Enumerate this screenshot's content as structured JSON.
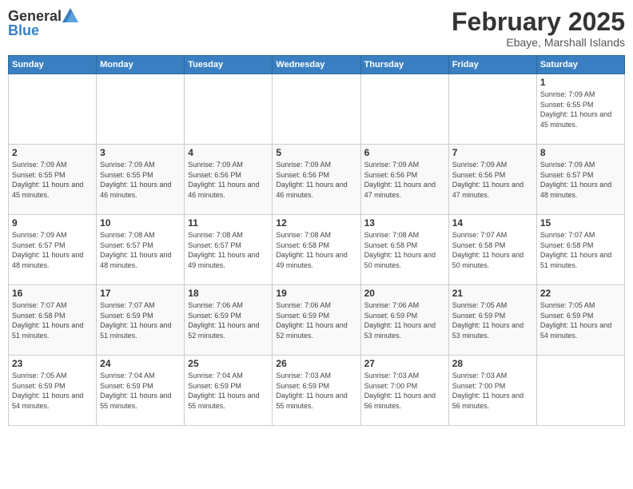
{
  "header": {
    "logo_general": "General",
    "logo_blue": "Blue",
    "month_title": "February 2025",
    "subtitle": "Ebaye, Marshall Islands"
  },
  "weekdays": [
    "Sunday",
    "Monday",
    "Tuesday",
    "Wednesday",
    "Thursday",
    "Friday",
    "Saturday"
  ],
  "weeks": [
    [
      {
        "day": "",
        "sunrise": "",
        "sunset": "",
        "daylight": ""
      },
      {
        "day": "",
        "sunrise": "",
        "sunset": "",
        "daylight": ""
      },
      {
        "day": "",
        "sunrise": "",
        "sunset": "",
        "daylight": ""
      },
      {
        "day": "",
        "sunrise": "",
        "sunset": "",
        "daylight": ""
      },
      {
        "day": "",
        "sunrise": "",
        "sunset": "",
        "daylight": ""
      },
      {
        "day": "",
        "sunrise": "",
        "sunset": "",
        "daylight": ""
      },
      {
        "day": "1",
        "sunrise": "Sunrise: 7:09 AM",
        "sunset": "Sunset: 6:55 PM",
        "daylight": "Daylight: 11 hours and 45 minutes."
      }
    ],
    [
      {
        "day": "2",
        "sunrise": "Sunrise: 7:09 AM",
        "sunset": "Sunset: 6:55 PM",
        "daylight": "Daylight: 11 hours and 45 minutes."
      },
      {
        "day": "3",
        "sunrise": "Sunrise: 7:09 AM",
        "sunset": "Sunset: 6:55 PM",
        "daylight": "Daylight: 11 hours and 46 minutes."
      },
      {
        "day": "4",
        "sunrise": "Sunrise: 7:09 AM",
        "sunset": "Sunset: 6:56 PM",
        "daylight": "Daylight: 11 hours and 46 minutes."
      },
      {
        "day": "5",
        "sunrise": "Sunrise: 7:09 AM",
        "sunset": "Sunset: 6:56 PM",
        "daylight": "Daylight: 11 hours and 46 minutes."
      },
      {
        "day": "6",
        "sunrise": "Sunrise: 7:09 AM",
        "sunset": "Sunset: 6:56 PM",
        "daylight": "Daylight: 11 hours and 47 minutes."
      },
      {
        "day": "7",
        "sunrise": "Sunrise: 7:09 AM",
        "sunset": "Sunset: 6:56 PM",
        "daylight": "Daylight: 11 hours and 47 minutes."
      },
      {
        "day": "8",
        "sunrise": "Sunrise: 7:09 AM",
        "sunset": "Sunset: 6:57 PM",
        "daylight": "Daylight: 11 hours and 48 minutes."
      }
    ],
    [
      {
        "day": "9",
        "sunrise": "Sunrise: 7:09 AM",
        "sunset": "Sunset: 6:57 PM",
        "daylight": "Daylight: 11 hours and 48 minutes."
      },
      {
        "day": "10",
        "sunrise": "Sunrise: 7:08 AM",
        "sunset": "Sunset: 6:57 PM",
        "daylight": "Daylight: 11 hours and 48 minutes."
      },
      {
        "day": "11",
        "sunrise": "Sunrise: 7:08 AM",
        "sunset": "Sunset: 6:57 PM",
        "daylight": "Daylight: 11 hours and 49 minutes."
      },
      {
        "day": "12",
        "sunrise": "Sunrise: 7:08 AM",
        "sunset": "Sunset: 6:58 PM",
        "daylight": "Daylight: 11 hours and 49 minutes."
      },
      {
        "day": "13",
        "sunrise": "Sunrise: 7:08 AM",
        "sunset": "Sunset: 6:58 PM",
        "daylight": "Daylight: 11 hours and 50 minutes."
      },
      {
        "day": "14",
        "sunrise": "Sunrise: 7:07 AM",
        "sunset": "Sunset: 6:58 PM",
        "daylight": "Daylight: 11 hours and 50 minutes."
      },
      {
        "day": "15",
        "sunrise": "Sunrise: 7:07 AM",
        "sunset": "Sunset: 6:58 PM",
        "daylight": "Daylight: 11 hours and 51 minutes."
      }
    ],
    [
      {
        "day": "16",
        "sunrise": "Sunrise: 7:07 AM",
        "sunset": "Sunset: 6:58 PM",
        "daylight": "Daylight: 11 hours and 51 minutes."
      },
      {
        "day": "17",
        "sunrise": "Sunrise: 7:07 AM",
        "sunset": "Sunset: 6:59 PM",
        "daylight": "Daylight: 11 hours and 51 minutes."
      },
      {
        "day": "18",
        "sunrise": "Sunrise: 7:06 AM",
        "sunset": "Sunset: 6:59 PM",
        "daylight": "Daylight: 11 hours and 52 minutes."
      },
      {
        "day": "19",
        "sunrise": "Sunrise: 7:06 AM",
        "sunset": "Sunset: 6:59 PM",
        "daylight": "Daylight: 11 hours and 52 minutes."
      },
      {
        "day": "20",
        "sunrise": "Sunrise: 7:06 AM",
        "sunset": "Sunset: 6:59 PM",
        "daylight": "Daylight: 11 hours and 53 minutes."
      },
      {
        "day": "21",
        "sunrise": "Sunrise: 7:05 AM",
        "sunset": "Sunset: 6:59 PM",
        "daylight": "Daylight: 11 hours and 53 minutes."
      },
      {
        "day": "22",
        "sunrise": "Sunrise: 7:05 AM",
        "sunset": "Sunset: 6:59 PM",
        "daylight": "Daylight: 11 hours and 54 minutes."
      }
    ],
    [
      {
        "day": "23",
        "sunrise": "Sunrise: 7:05 AM",
        "sunset": "Sunset: 6:59 PM",
        "daylight": "Daylight: 11 hours and 54 minutes."
      },
      {
        "day": "24",
        "sunrise": "Sunrise: 7:04 AM",
        "sunset": "Sunset: 6:59 PM",
        "daylight": "Daylight: 11 hours and 55 minutes."
      },
      {
        "day": "25",
        "sunrise": "Sunrise: 7:04 AM",
        "sunset": "Sunset: 6:59 PM",
        "daylight": "Daylight: 11 hours and 55 minutes."
      },
      {
        "day": "26",
        "sunrise": "Sunrise: 7:03 AM",
        "sunset": "Sunset: 6:59 PM",
        "daylight": "Daylight: 11 hours and 55 minutes."
      },
      {
        "day": "27",
        "sunrise": "Sunrise: 7:03 AM",
        "sunset": "Sunset: 7:00 PM",
        "daylight": "Daylight: 11 hours and 56 minutes."
      },
      {
        "day": "28",
        "sunrise": "Sunrise: 7:03 AM",
        "sunset": "Sunset: 7:00 PM",
        "daylight": "Daylight: 11 hours and 56 minutes."
      },
      {
        "day": "",
        "sunrise": "",
        "sunset": "",
        "daylight": ""
      }
    ]
  ]
}
